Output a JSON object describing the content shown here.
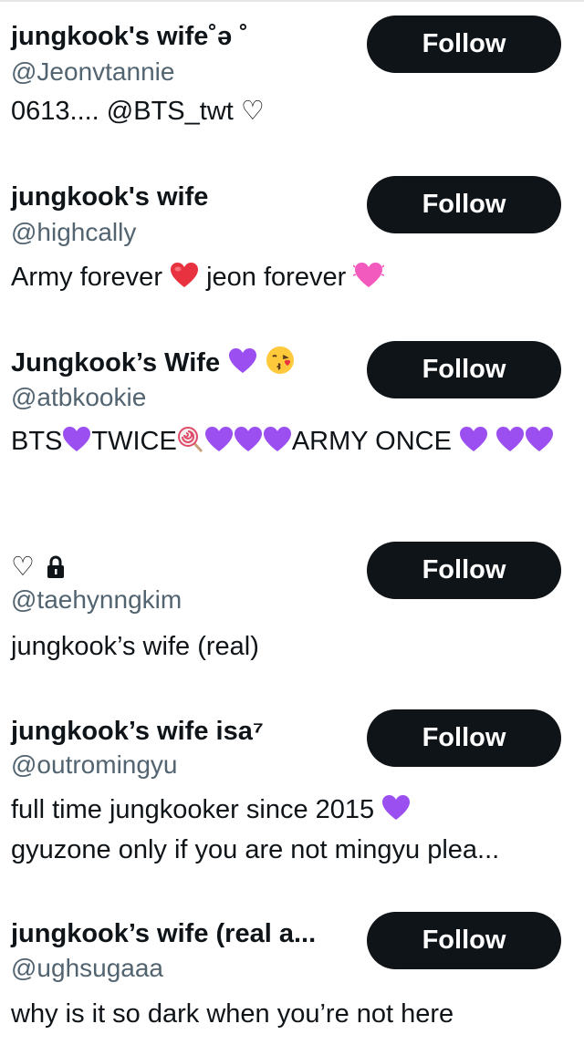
{
  "users": [
    {
      "name": "jungkook's wife˚ə ˚",
      "handle": "@Jeonvtannie",
      "bio": "0613.... @BTS_twt ♡",
      "follow_label": "Follow"
    },
    {
      "name": "jungkook's wife",
      "handle": "@highcally",
      "bio_parts": [
        "Army forever ",
        "heart-red",
        " jeon forever ",
        "heart-pink"
      ],
      "bio_text_1": "Army forever",
      "bio_text_2": "jeon forever",
      "follow_label": "Follow"
    },
    {
      "name": "Jungkook’s Wife",
      "handle": "@atbkookie",
      "bio_text_1": "BTS",
      "bio_text_2": "TWICE",
      "bio_text_3": "ARMY ONCE",
      "follow_label": "Follow"
    },
    {
      "name": "♡",
      "handle": "@taehynngkim",
      "bio": "jungkook’s wife (real)",
      "follow_label": "Follow"
    },
    {
      "name": "jungkook’s wife isa⁷",
      "handle": "@outromingyu",
      "bio_line_1": "full time jungkooker since 2015",
      "bio_line_2": "gyuzone only if you are not mingyu plea...",
      "follow_label": "Follow"
    },
    {
      "name": "jungkook’s wife (real a...",
      "handle": "@ughsugaaa",
      "bio": "why is it so dark when you’re not here",
      "follow_label": "Follow"
    }
  ],
  "colors": {
    "button_bg": "#0f1419",
    "button_text": "#ffffff",
    "handle": "#536471",
    "purple_heart": "#9b4ff0",
    "red_heart": "#e8323f",
    "pink_heart": "#f25bbd"
  },
  "icons": [
    "purple-heart-icon",
    "red-heart-icon",
    "pink-heart-icon",
    "kissing-face-icon",
    "lollipop-icon",
    "lock-icon",
    "outline-heart-icon"
  ]
}
